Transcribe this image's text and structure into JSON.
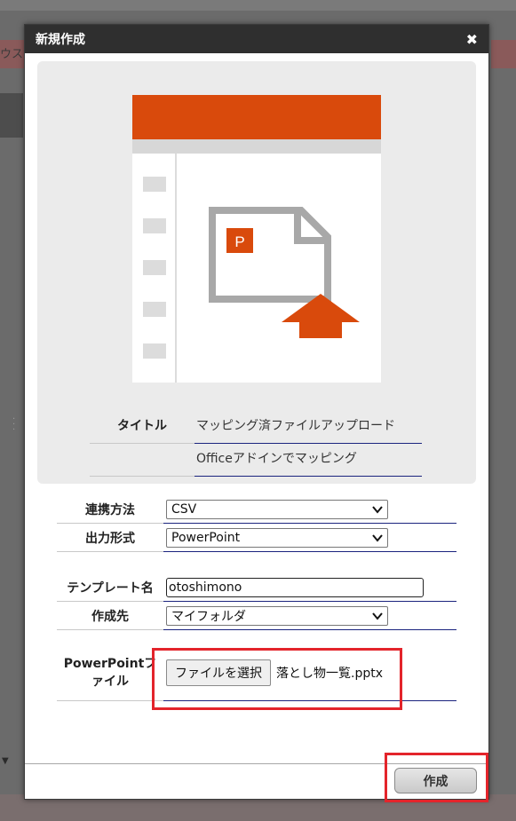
{
  "background": {
    "left_fragment": "ウス"
  },
  "dialog": {
    "title": "新規作成",
    "close_glyph": "✖"
  },
  "preview": {
    "icon_letter": "P",
    "rows": [
      {
        "label": "タイトル",
        "value": "マッピング済ファイルアップロード"
      },
      {
        "label": "",
        "value": "Officeアドインでマッピング"
      }
    ]
  },
  "form": {
    "link_method": {
      "label": "連携方法",
      "value": "CSV"
    },
    "output_format": {
      "label": "出力形式",
      "value": "PowerPoint"
    },
    "template_name": {
      "label": "テンプレート名",
      "value": "otoshimono"
    },
    "destination": {
      "label": "作成先",
      "value": "マイフォルダ"
    },
    "powerpoint_file": {
      "label_line1": "PowerPointフ",
      "label_line2": "ァイル",
      "button_label": "ファイルを選択",
      "file_name": "落とし物一覧.pptx"
    }
  },
  "footer": {
    "create_label": "作成"
  },
  "colors": {
    "accent_orange": "#d94a0c",
    "highlight_red": "#e3242b",
    "titlebar": "#2f2f2f",
    "underline_navy": "#1a237e"
  }
}
